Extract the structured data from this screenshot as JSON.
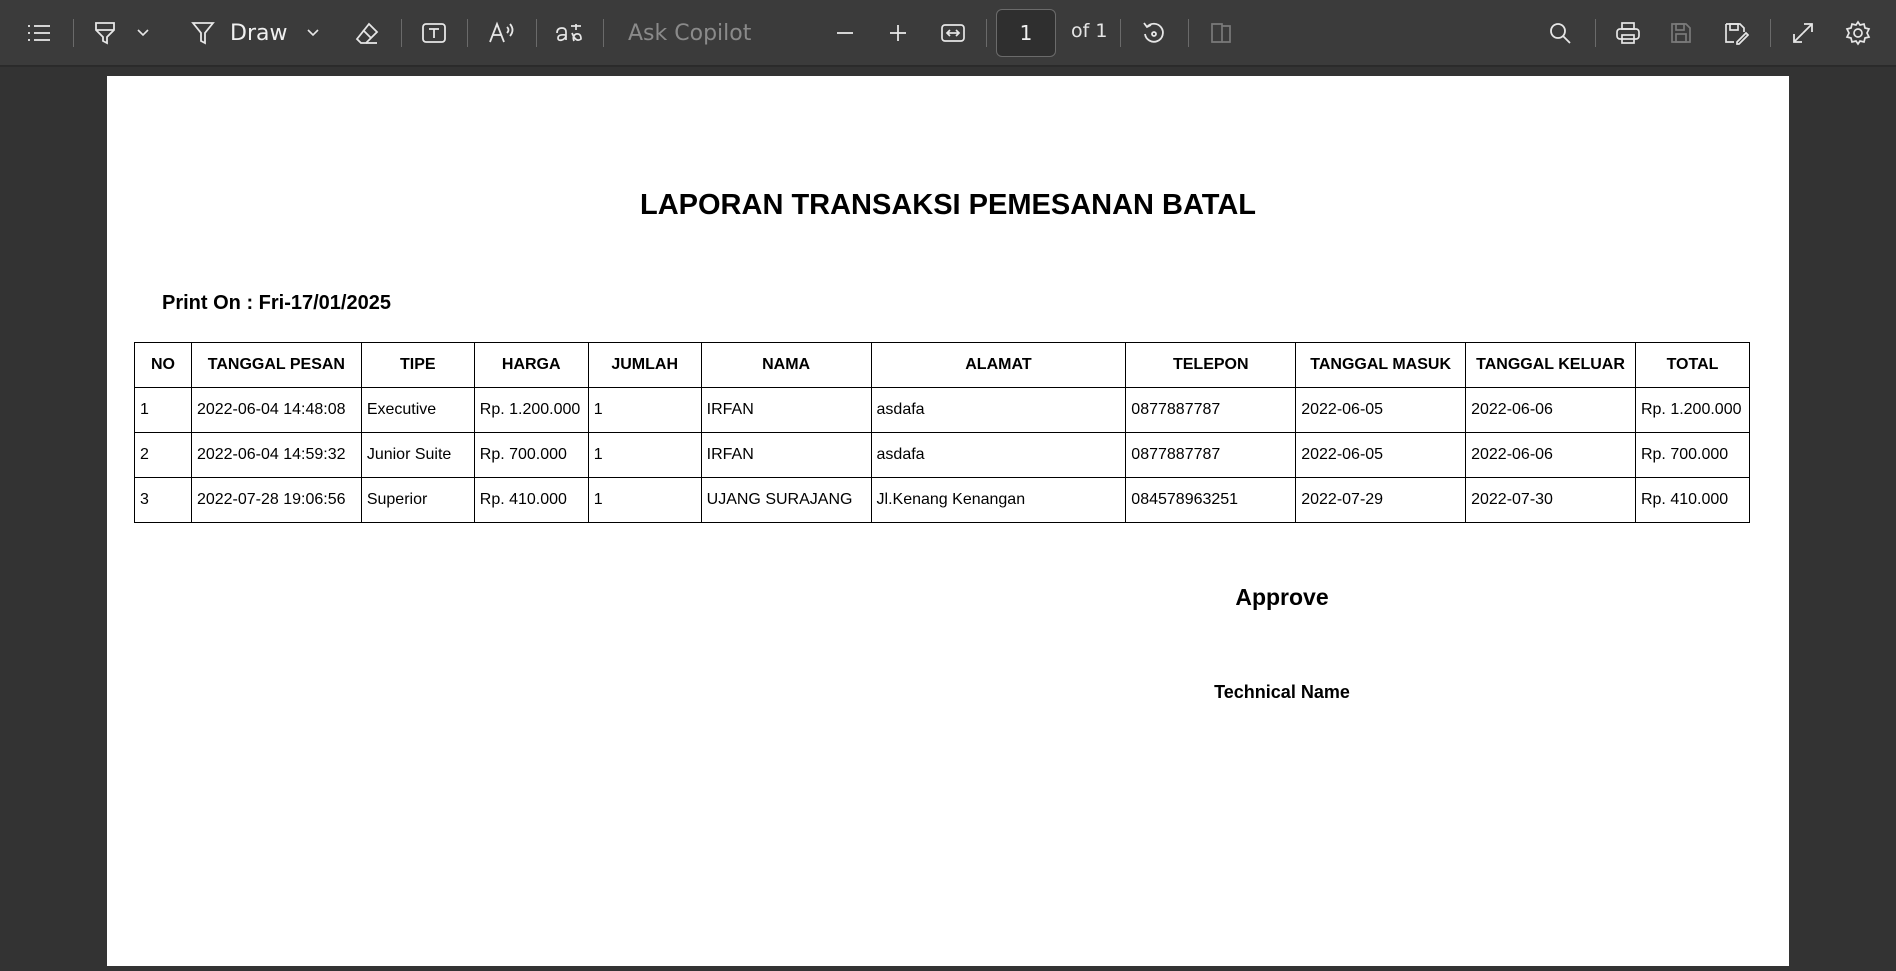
{
  "toolbar": {
    "draw_label": "Draw",
    "copilot_placeholder": "Ask Copilot",
    "page_current": "1",
    "page_of": "of 1"
  },
  "icons": [
    "contents-icon",
    "highlighter-icon",
    "chevron-down-icon",
    "draw-pen-icon",
    "eraser-icon",
    "text-box-icon",
    "read-aloud-icon",
    "translate-icon",
    "zoom-out-icon",
    "zoom-in-icon",
    "fit-width-icon",
    "rotate-icon",
    "page-view-icon",
    "search-icon",
    "print-icon",
    "save-icon",
    "save-as-icon",
    "fullscreen-icon",
    "settings-icon"
  ],
  "document": {
    "title": "LAPORAN TRANSAKSI PEMESANAN BATAL",
    "print_on": "Print On : Fri-17/01/2025",
    "table": {
      "headers": [
        "NO",
        "TANGGAL PESAN",
        "TIPE",
        "HARGA",
        "JUMLAH",
        "NAMA",
        "ALAMAT",
        "TELEPON",
        "TANGGAL MASUK",
        "TANGGAL KELUAR",
        "TOTAL"
      ],
      "rows": [
        [
          "1",
          "2022-06-04 14:48:08",
          "Executive",
          "Rp. 1.200.000",
          "1",
          "IRFAN",
          "asdafa",
          "0877887787",
          "2022-06-05",
          "2022-06-06",
          "Rp. 1.200.000"
        ],
        [
          "2",
          "2022-06-04 14:59:32",
          "Junior Suite",
          "Rp. 700.000",
          "1",
          "IRFAN",
          "asdafa",
          "0877887787",
          "2022-06-05",
          "2022-06-06",
          "Rp. 700.000"
        ],
        [
          "3",
          "2022-07-28 19:06:56",
          "Superior",
          "Rp. 410.000",
          "1",
          "UJANG SURAJANG",
          "Jl.Kenang Kenangan",
          "084578963251",
          "2022-07-29",
          "2022-07-30",
          "Rp. 410.000"
        ]
      ]
    },
    "approve": "Approve",
    "technical_name": "Technical Name"
  }
}
